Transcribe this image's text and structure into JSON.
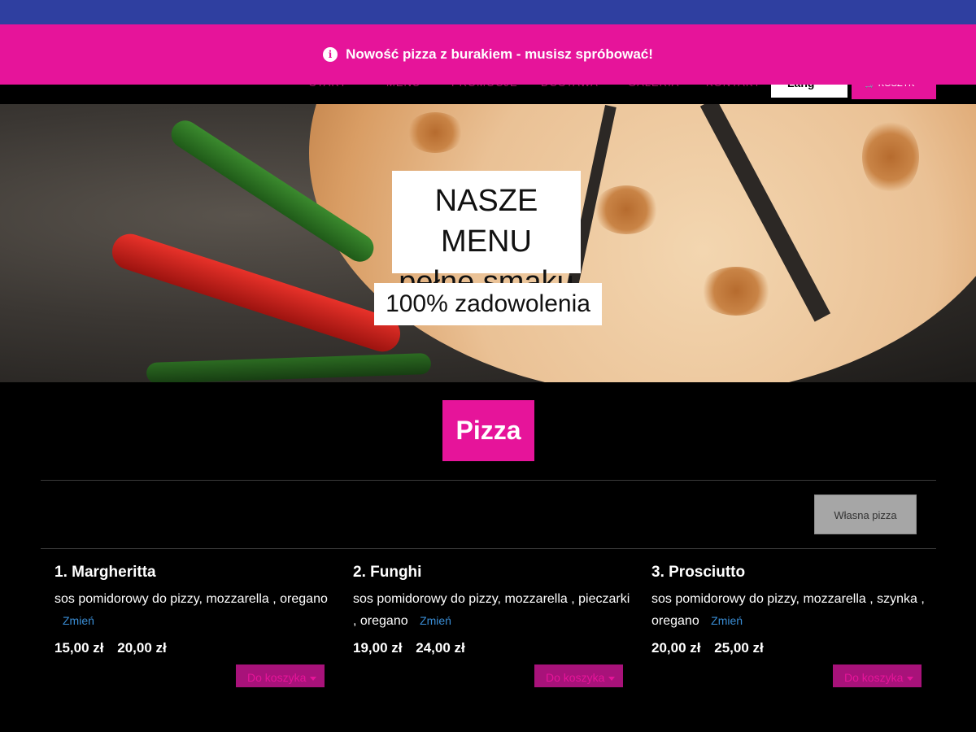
{
  "colors": {
    "topbar": "#2f3fa0",
    "accent": "#e6149a",
    "dark_accent": "#a8127a",
    "link": "#3a8ed6"
  },
  "notification": {
    "icon": "info-icon",
    "text": "Nowość pizza z burakiem - musisz spróbować!"
  },
  "nav": {
    "items": [
      "START",
      "MENU",
      "PROMOCJE",
      "DOSTAWA",
      "GALERIA",
      "KONTAKT"
    ],
    "language": "Lang",
    "cart_label": "KOSZYK"
  },
  "hero": {
    "title_line1": "NASZE MENU",
    "title_line2": "pełne smaku",
    "subtitle": "100% zadowolenia"
  },
  "category": {
    "title": "Pizza",
    "custom_button": "Własna pizza"
  },
  "items": [
    {
      "name": "1. Margheritta",
      "desc": "sos pomidorowy do pizzy, mozzarella , oregano",
      "change": "Zmień",
      "prices": [
        "15,00 zł",
        "20,00 zł"
      ],
      "cart_label": "Do koszyka"
    },
    {
      "name": "2. Funghi",
      "desc": "sos pomidorowy do pizzy, mozzarella , pieczarki , oregano",
      "change": "Zmień",
      "prices": [
        "19,00 zł",
        "24,00 zł"
      ],
      "cart_label": "Do koszyka"
    },
    {
      "name": "3. Prosciutto",
      "desc": "sos pomidorowy do pizzy, mozzarella , szynka , oregano",
      "change": "Zmień",
      "prices": [
        "20,00 zł",
        "25,00 zł"
      ],
      "cart_label": "Do koszyka"
    }
  ]
}
